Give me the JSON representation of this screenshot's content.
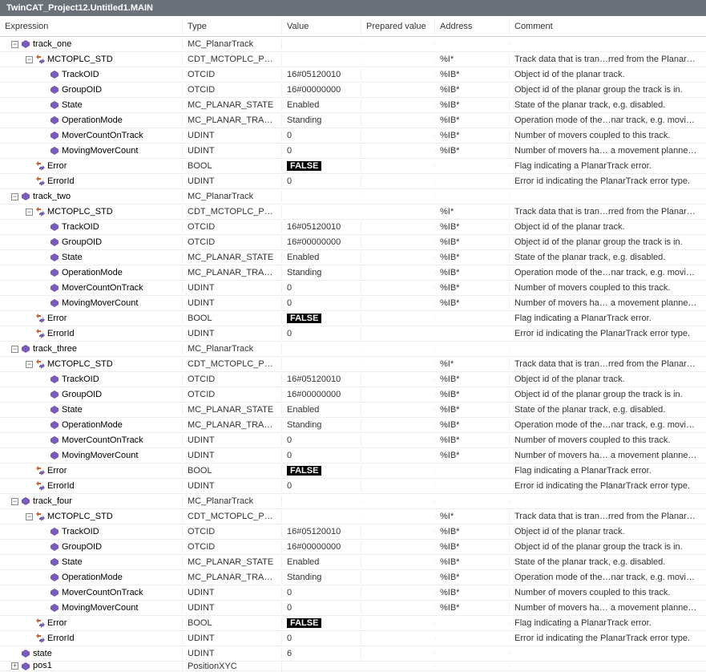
{
  "title": "TwinCAT_Project12.Untitled1.MAIN",
  "headers": {
    "expression": "Expression",
    "type": "Type",
    "value": "Value",
    "prepared": "Prepared value",
    "address": "Address",
    "comment": "Comment"
  },
  "rows": [
    {
      "depth": 0,
      "exp": "-",
      "kind": "var",
      "name": "track_one",
      "type": "MC_PlanarTrack",
      "value": "",
      "addr": "",
      "comment": ""
    },
    {
      "depth": 1,
      "exp": "-",
      "kind": "ref",
      "name": "MCTOPLC_STD",
      "type": "CDT_MCTOPLC_PLA…",
      "value": "",
      "addr": "%I*",
      "comment": "Track data that is tran…rred from the Planar…"
    },
    {
      "depth": 2,
      "exp": "",
      "kind": "var",
      "name": "TrackOID",
      "type": "OTCID",
      "value": "16#05120010",
      "addr": "%IB*",
      "comment": "Object id of the planar track."
    },
    {
      "depth": 2,
      "exp": "",
      "kind": "var",
      "name": "GroupOID",
      "type": "OTCID",
      "value": "16#00000000",
      "addr": "%IB*",
      "comment": "Object id of the planar group the track is in."
    },
    {
      "depth": 2,
      "exp": "",
      "kind": "var",
      "name": "State",
      "type": "MC_PLANAR_STATE",
      "value": "Enabled",
      "addr": "%IB*",
      "comment": "State of the planar track, e.g. disabled."
    },
    {
      "depth": 2,
      "exp": "",
      "kind": "var",
      "name": "OperationMode",
      "type": "MC_PLANAR_TRACK…",
      "value": "Standing",
      "addr": "%IB*",
      "comment": "Operation mode of the…nar track, e.g. movi…"
    },
    {
      "depth": 2,
      "exp": "",
      "kind": "var",
      "name": "MoverCountOnTrack",
      "type": "UDINT",
      "value": "0",
      "addr": "%IB*",
      "comment": "Number of movers coupled to this track."
    },
    {
      "depth": 2,
      "exp": "",
      "kind": "var",
      "name": "MovingMoverCount",
      "type": "UDINT",
      "value": "0",
      "addr": "%IB*",
      "comment": "Number of movers ha… a movement planne…"
    },
    {
      "depth": 1,
      "exp": "",
      "kind": "ref",
      "name": "Error",
      "type": "BOOL",
      "value": "FALSE",
      "valBool": true,
      "addr": "",
      "comment": "Flag indicating a PlanarTrack error."
    },
    {
      "depth": 1,
      "exp": "",
      "kind": "ref",
      "name": "ErrorId",
      "type": "UDINT",
      "value": "0",
      "addr": "",
      "comment": "Error id indicating the PlanarTrack error type."
    },
    {
      "depth": 0,
      "exp": "-",
      "kind": "var",
      "name": "track_two",
      "type": "MC_PlanarTrack",
      "value": "",
      "addr": "",
      "comment": ""
    },
    {
      "depth": 1,
      "exp": "-",
      "kind": "ref",
      "name": "MCTOPLC_STD",
      "type": "CDT_MCTOPLC_PLA…",
      "value": "",
      "addr": "%I*",
      "comment": "Track data that is tran…rred from the Planar…"
    },
    {
      "depth": 2,
      "exp": "",
      "kind": "var",
      "name": "TrackOID",
      "type": "OTCID",
      "value": "16#05120010",
      "addr": "%IB*",
      "comment": "Object id of the planar track."
    },
    {
      "depth": 2,
      "exp": "",
      "kind": "var",
      "name": "GroupOID",
      "type": "OTCID",
      "value": "16#00000000",
      "addr": "%IB*",
      "comment": "Object id of the planar group the track is in."
    },
    {
      "depth": 2,
      "exp": "",
      "kind": "var",
      "name": "State",
      "type": "MC_PLANAR_STATE",
      "value": "Enabled",
      "addr": "%IB*",
      "comment": "State of the planar track, e.g. disabled."
    },
    {
      "depth": 2,
      "exp": "",
      "kind": "var",
      "name": "OperationMode",
      "type": "MC_PLANAR_TRACK…",
      "value": "Standing",
      "addr": "%IB*",
      "comment": "Operation mode of the…nar track, e.g. movi…"
    },
    {
      "depth": 2,
      "exp": "",
      "kind": "var",
      "name": "MoverCountOnTrack",
      "type": "UDINT",
      "value": "0",
      "addr": "%IB*",
      "comment": "Number of movers coupled to this track."
    },
    {
      "depth": 2,
      "exp": "",
      "kind": "var",
      "name": "MovingMoverCount",
      "type": "UDINT",
      "value": "0",
      "addr": "%IB*",
      "comment": "Number of movers ha… a movement planne…"
    },
    {
      "depth": 1,
      "exp": "",
      "kind": "ref",
      "name": "Error",
      "type": "BOOL",
      "value": "FALSE",
      "valBool": true,
      "addr": "",
      "comment": "Flag indicating a PlanarTrack error."
    },
    {
      "depth": 1,
      "exp": "",
      "kind": "ref",
      "name": "ErrorId",
      "type": "UDINT",
      "value": "0",
      "addr": "",
      "comment": "Error id indicating the PlanarTrack error type."
    },
    {
      "depth": 0,
      "exp": "-",
      "kind": "var",
      "name": "track_three",
      "type": "MC_PlanarTrack",
      "value": "",
      "addr": "",
      "comment": ""
    },
    {
      "depth": 1,
      "exp": "-",
      "kind": "ref",
      "name": "MCTOPLC_STD",
      "type": "CDT_MCTOPLC_PLA…",
      "value": "",
      "addr": "%I*",
      "comment": "Track data that is tran…rred from the Planar…"
    },
    {
      "depth": 2,
      "exp": "",
      "kind": "var",
      "name": "TrackOID",
      "type": "OTCID",
      "value": "16#05120010",
      "addr": "%IB*",
      "comment": "Object id of the planar track."
    },
    {
      "depth": 2,
      "exp": "",
      "kind": "var",
      "name": "GroupOID",
      "type": "OTCID",
      "value": "16#00000000",
      "addr": "%IB*",
      "comment": "Object id of the planar group the track is in."
    },
    {
      "depth": 2,
      "exp": "",
      "kind": "var",
      "name": "State",
      "type": "MC_PLANAR_STATE",
      "value": "Enabled",
      "addr": "%IB*",
      "comment": "State of the planar track, e.g. disabled."
    },
    {
      "depth": 2,
      "exp": "",
      "kind": "var",
      "name": "OperationMode",
      "type": "MC_PLANAR_TRACK…",
      "value": "Standing",
      "addr": "%IB*",
      "comment": "Operation mode of the…nar track, e.g. movi…"
    },
    {
      "depth": 2,
      "exp": "",
      "kind": "var",
      "name": "MoverCountOnTrack",
      "type": "UDINT",
      "value": "0",
      "addr": "%IB*",
      "comment": "Number of movers coupled to this track."
    },
    {
      "depth": 2,
      "exp": "",
      "kind": "var",
      "name": "MovingMoverCount",
      "type": "UDINT",
      "value": "0",
      "addr": "%IB*",
      "comment": "Number of movers ha… a movement planne…"
    },
    {
      "depth": 1,
      "exp": "",
      "kind": "ref",
      "name": "Error",
      "type": "BOOL",
      "value": "FALSE",
      "valBool": true,
      "addr": "",
      "comment": "Flag indicating a PlanarTrack error."
    },
    {
      "depth": 1,
      "exp": "",
      "kind": "ref",
      "name": "ErrorId",
      "type": "UDINT",
      "value": "0",
      "addr": "",
      "comment": "Error id indicating the PlanarTrack error type."
    },
    {
      "depth": 0,
      "exp": "-",
      "kind": "var",
      "name": "track_four",
      "type": "MC_PlanarTrack",
      "value": "",
      "addr": "",
      "comment": ""
    },
    {
      "depth": 1,
      "exp": "-",
      "kind": "ref",
      "name": "MCTOPLC_STD",
      "type": "CDT_MCTOPLC_PLA…",
      "value": "",
      "addr": "%I*",
      "comment": "Track data that is tran…rred from the Planar…"
    },
    {
      "depth": 2,
      "exp": "",
      "kind": "var",
      "name": "TrackOID",
      "type": "OTCID",
      "value": "16#05120010",
      "addr": "%IB*",
      "comment": "Object id of the planar track."
    },
    {
      "depth": 2,
      "exp": "",
      "kind": "var",
      "name": "GroupOID",
      "type": "OTCID",
      "value": "16#00000000",
      "addr": "%IB*",
      "comment": "Object id of the planar group the track is in."
    },
    {
      "depth": 2,
      "exp": "",
      "kind": "var",
      "name": "State",
      "type": "MC_PLANAR_STATE",
      "value": "Enabled",
      "addr": "%IB*",
      "comment": "State of the planar track, e.g. disabled."
    },
    {
      "depth": 2,
      "exp": "",
      "kind": "var",
      "name": "OperationMode",
      "type": "MC_PLANAR_TRACK…",
      "value": "Standing",
      "addr": "%IB*",
      "comment": "Operation mode of the…nar track, e.g. movi…"
    },
    {
      "depth": 2,
      "exp": "",
      "kind": "var",
      "name": "MoverCountOnTrack",
      "type": "UDINT",
      "value": "0",
      "addr": "%IB*",
      "comment": "Number of movers coupled to this track."
    },
    {
      "depth": 2,
      "exp": "",
      "kind": "var",
      "name": "MovingMoverCount",
      "type": "UDINT",
      "value": "0",
      "addr": "%IB*",
      "comment": "Number of movers ha… a movement planne…"
    },
    {
      "depth": 1,
      "exp": "",
      "kind": "ref",
      "name": "Error",
      "type": "BOOL",
      "value": "FALSE",
      "valBool": true,
      "addr": "",
      "comment": "Flag indicating a PlanarTrack error."
    },
    {
      "depth": 1,
      "exp": "",
      "kind": "ref",
      "name": "ErrorId",
      "type": "UDINT",
      "value": "0",
      "addr": "",
      "comment": "Error id indicating the PlanarTrack error type."
    },
    {
      "depth": 0,
      "exp": "",
      "kind": "var",
      "name": "state",
      "type": "UDINT",
      "value": "6",
      "addr": "",
      "comment": ""
    },
    {
      "depth": 0,
      "exp": "+",
      "kind": "var",
      "name": "pos1",
      "type": "PositionXYC",
      "value": "",
      "addr": "",
      "comment": "",
      "cut": true
    }
  ]
}
